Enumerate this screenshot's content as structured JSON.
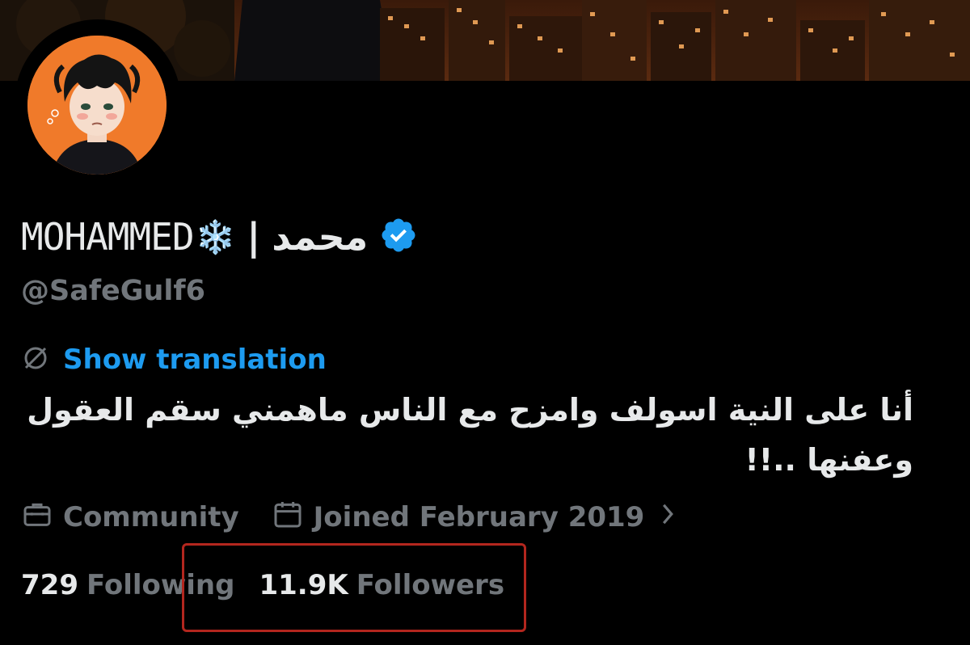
{
  "profile": {
    "name_latin": "MOHAMMED",
    "name_emoji": "❄️",
    "name_separator": "|",
    "name_arabic": "محمد",
    "verified": true,
    "handle": "@SafeGulf6",
    "show_translation_label": "Show translation",
    "bio_lines": [
      "أنا على النية اسولف وامزح مع الناس ماهمني سقم العقول",
      "وعفنها ..!!"
    ],
    "category_label": "Community",
    "joined_label": "Joined February 2019",
    "following_count": "729",
    "following_label": "Following",
    "followers_count": "11.9K",
    "followers_label": "Followers"
  },
  "icons": {
    "verified": "verified-badge-icon",
    "translate": "translate-icon",
    "category": "briefcase-icon",
    "joined": "calendar-icon",
    "chevron": "chevron-right-icon"
  },
  "colors": {
    "background": "#000000",
    "primary_text": "#e7e9ea",
    "secondary_text": "#71767b",
    "link": "#1d9bf0",
    "verified": "#1d9bf0",
    "highlight_box": "#b3261e",
    "avatar_bg": "#f07a2a"
  }
}
